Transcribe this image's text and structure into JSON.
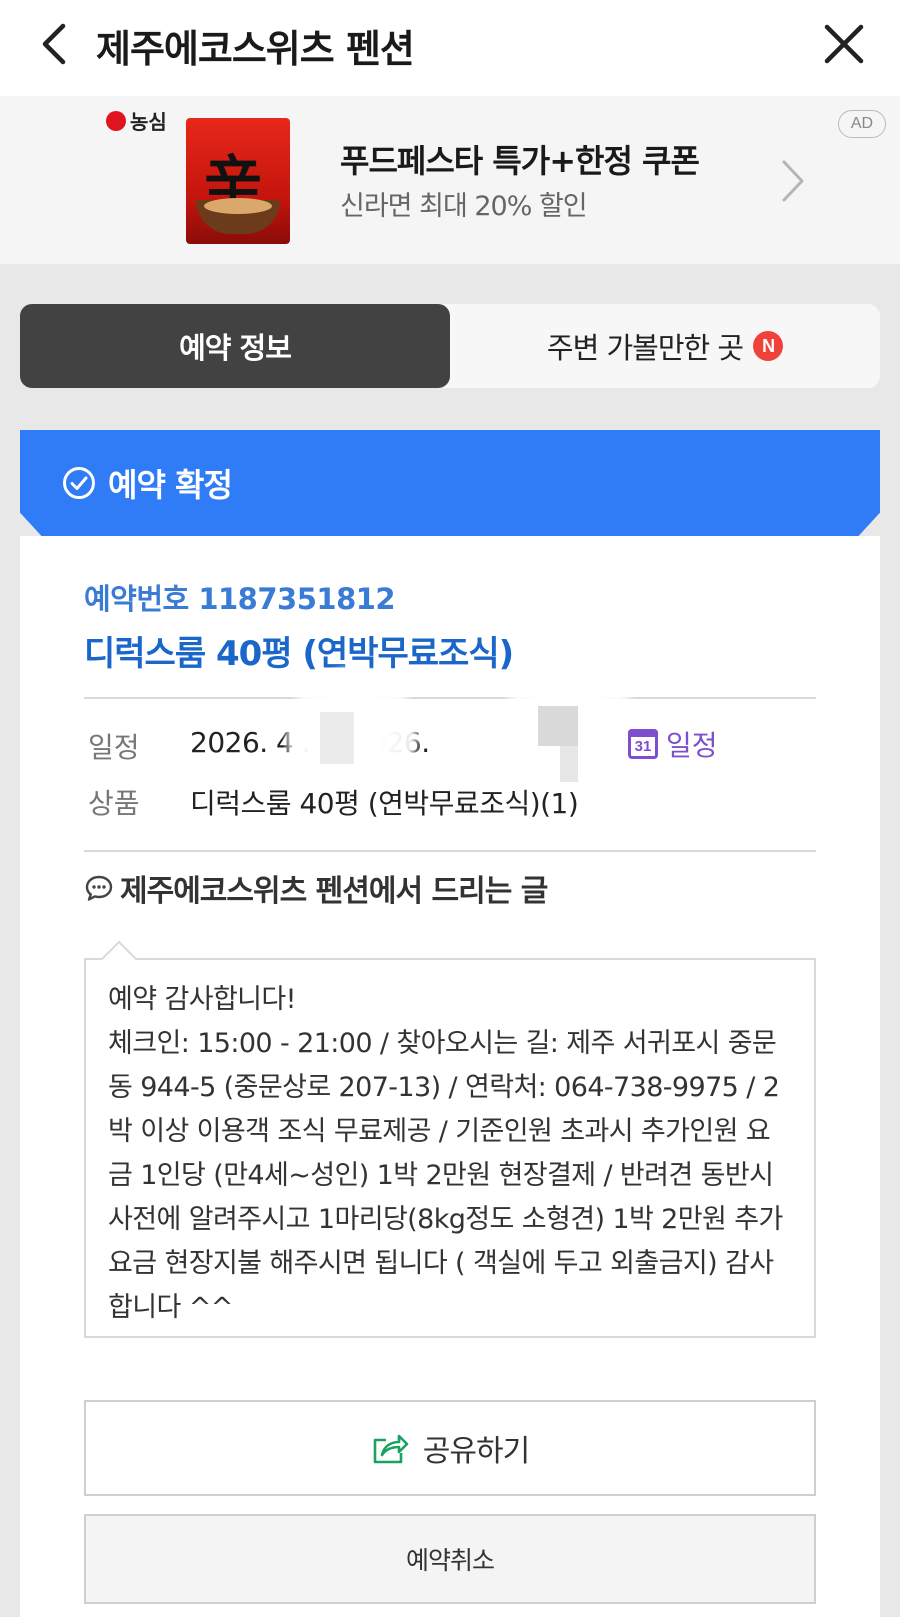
{
  "header": {
    "title": "제주에코스위츠 펜션"
  },
  "ad": {
    "brand": "농심",
    "headline": "푸드페스타 특가+한정 쿠폰",
    "subline": "신라면 최대 20% 할인",
    "badge": "AD",
    "product_glyph": "辛"
  },
  "tabs": [
    {
      "label": "예약 정보",
      "active": true
    },
    {
      "label": "주변 가볼만한 곳",
      "badge": "N",
      "active": false
    }
  ],
  "status": {
    "label": "예약 확정",
    "color": "#2f7cf6"
  },
  "reservation": {
    "number_line": "예약번호 1187351812",
    "room_title": "디럭스룸 40평 (연박무료조식)",
    "schedule_label": "일정",
    "schedule_value": "2026. 4  .   )~2026.",
    "schedule_link": "일정",
    "calendar_day": "31",
    "product_label": "상품",
    "product_value": "디럭스룸 40평 (연박무료조식)(1)"
  },
  "message": {
    "title": "제주에코스위츠 펜션에서 드리는 글",
    "body": "예약 감사합니다!\n체크인: 15:00 - 21:00 / 찾아오시는 길: 제주 서귀포시 중문동 944-5 (중문상로 207-13) / 연락처: 064-738-9975 / 2박 이상 이용객 조식 무료제공 / 기준인원 초과시 추가인원 요금 1인당 (만4세~성인) 1박 2만원 현장결제 / 반려견 동반시 사전에 알려주시고 1마리당(8kg정도 소형견) 1박 2만원 추가요금 현장지불 해주시면 됩니다 ( 객실에 두고 외출금지) 감사합니다 ^^"
  },
  "actions": {
    "share_label": "공유하기",
    "cancel_label": "예약취소"
  },
  "colors": {
    "accent_blue": "#2f7cf6",
    "link_blue": "#1a66c9",
    "schedule_purple": "#7d4fcf",
    "tab_dark": "#424242",
    "badge_red": "#f0413b",
    "share_green": "#1aa260"
  }
}
